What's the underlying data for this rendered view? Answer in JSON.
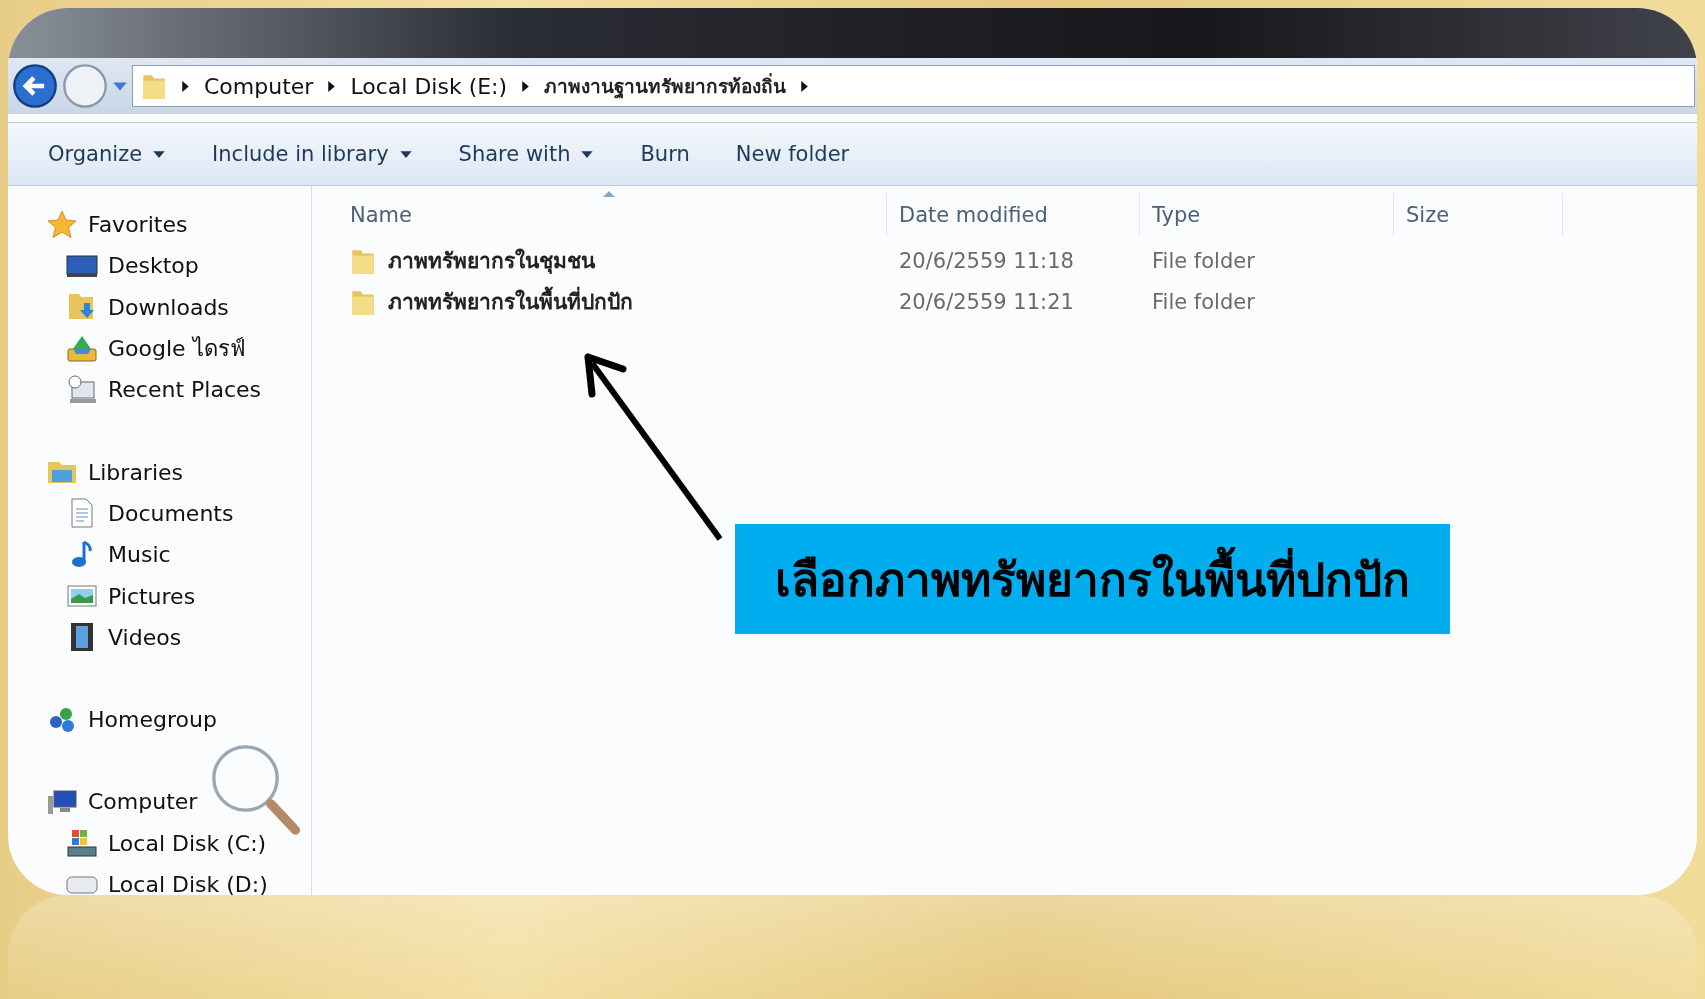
{
  "address_bar": {
    "breadcrumb": [
      "Computer",
      "Local Disk (E:)",
      "ภาพงานฐานทรัพยากรท้องถิ่น"
    ]
  },
  "toolbar": [
    {
      "label": "Organize",
      "dropdown": true
    },
    {
      "label": "Include in library",
      "dropdown": true
    },
    {
      "label": "Share with",
      "dropdown": true
    },
    {
      "label": "Burn",
      "dropdown": false
    },
    {
      "label": "New folder",
      "dropdown": false
    }
  ],
  "sidebar": [
    {
      "label": "Favorites",
      "kind": "star",
      "children": [
        {
          "label": "Desktop",
          "kind": "desktop"
        },
        {
          "label": "Downloads",
          "kind": "downloads"
        },
        {
          "label": "Google ไดรฟ์",
          "kind": "cloud-drive"
        },
        {
          "label": "Recent Places",
          "kind": "recent"
        }
      ]
    },
    {
      "label": "Libraries",
      "kind": "library",
      "children": [
        {
          "label": "Documents",
          "kind": "document"
        },
        {
          "label": "Music",
          "kind": "music"
        },
        {
          "label": "Pictures",
          "kind": "pictures"
        },
        {
          "label": "Videos",
          "kind": "videos"
        }
      ]
    },
    {
      "label": "Homegroup",
      "kind": "homegroup"
    },
    {
      "label": "Computer",
      "kind": "computer",
      "children": [
        {
          "label": "Local Disk (C:)",
          "kind": "windows-disk"
        },
        {
          "label": "Local Disk (D:)",
          "kind": "disk"
        }
      ]
    }
  ],
  "table": {
    "columns": [
      "Name",
      "Date modified",
      "Type",
      "Size"
    ],
    "rows": [
      {
        "name": "ภาพทรัพยากรในชุมชน",
        "date_modified": "20/6/2559 11:18",
        "type": "File folder"
      },
      {
        "name": "ภาพทรัพยากรในพื้นที่ปกปัก",
        "date_modified": "20/6/2559 11:21",
        "type": "File folder"
      }
    ]
  },
  "callout": {
    "text": "เลือกภาพทรัพยากรในพื้นที่ปกปัก"
  }
}
